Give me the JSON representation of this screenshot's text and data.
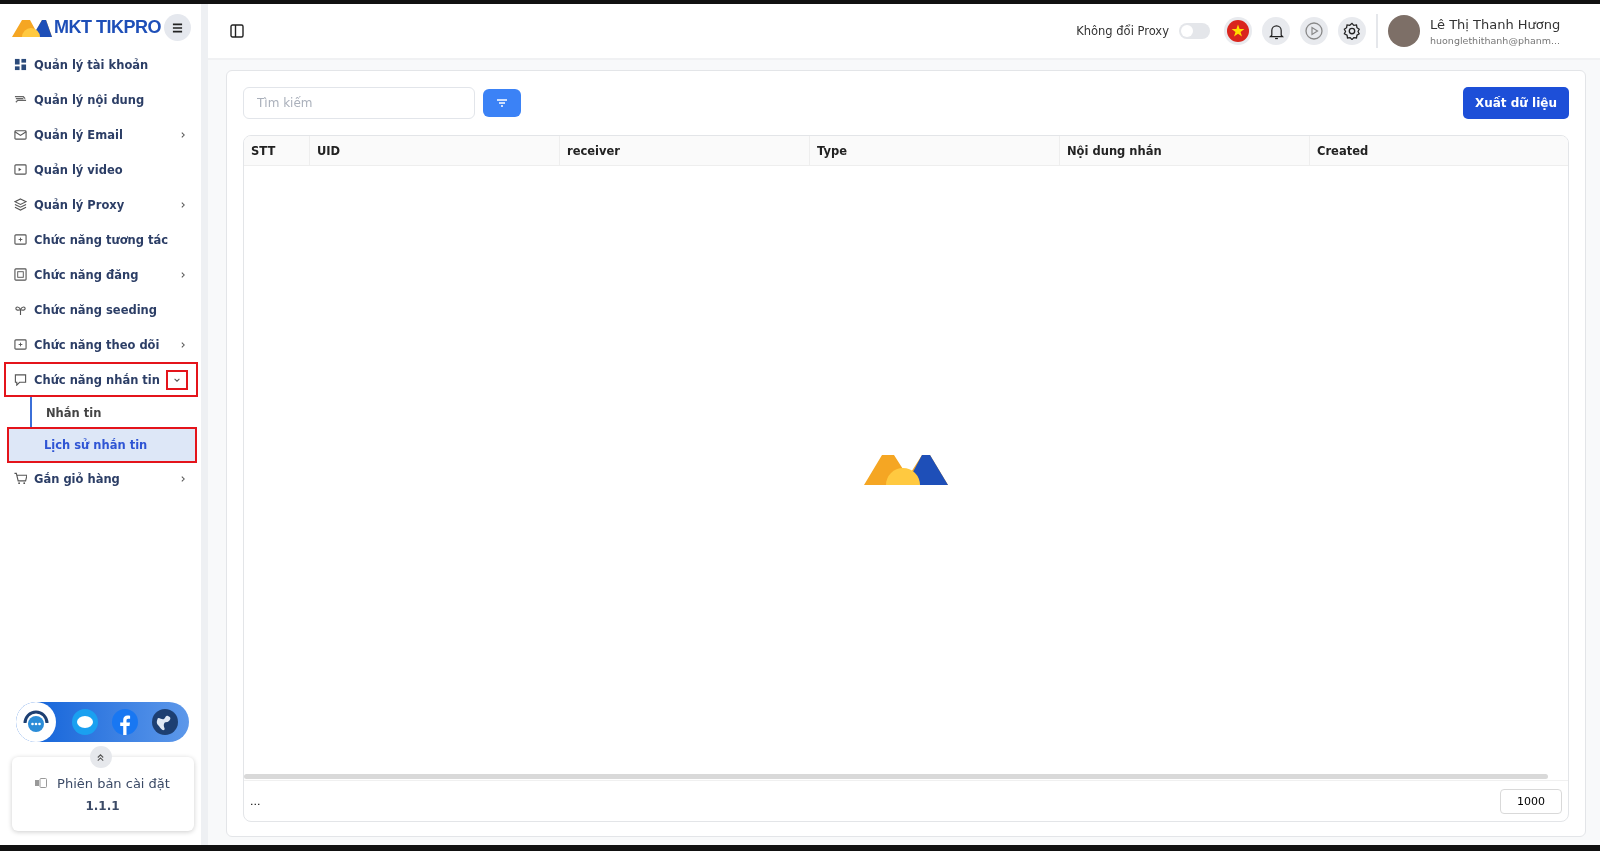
{
  "brand": {
    "name": "MKT TIKPRO"
  },
  "sidebar": {
    "items": [
      {
        "label": "Quản lý tài khoản",
        "highlighted": false
      },
      {
        "label": "Quản lý nội dung",
        "highlighted": false
      },
      {
        "label": "Quản lý Email",
        "expanded": false,
        "highlighted": false
      },
      {
        "label": "Quản lý video",
        "highlighted": false
      },
      {
        "label": "Quản lý Proxy",
        "expanded": false,
        "highlighted": false
      },
      {
        "label": "Chức năng tương tác",
        "highlighted": false
      },
      {
        "label": "Chức năng đăng",
        "expanded": false,
        "highlighted": false
      },
      {
        "label": "Chức năng seeding",
        "highlighted": false
      },
      {
        "label": "Chức năng theo dõi",
        "expanded": false,
        "highlighted": false
      },
      {
        "label": "Chức năng nhắn tin",
        "expanded": true,
        "highlighted": true,
        "children": [
          {
            "label": "Nhắn tin",
            "selected": false,
            "highlighted": false
          },
          {
            "label": "Lịch sử nhắn tin",
            "selected": true,
            "highlighted": true
          }
        ]
      },
      {
        "label": "Gắn giỏ hàng",
        "expanded": false,
        "highlighted": false
      }
    ]
  },
  "version_card": {
    "label": "Phiên bản cài đặt",
    "version": "1.1.1"
  },
  "header": {
    "proxy_toggle": {
      "label": "Không đổi Proxy",
      "on": false
    },
    "user": {
      "name": "Lê Thị Thanh Hương",
      "email": "huonglethithanh@phanm..."
    }
  },
  "toolbar": {
    "search": {
      "placeholder": "Tìm kiếm"
    },
    "export_button": "Xuất dữ liệu"
  },
  "table": {
    "columns": [
      "STT",
      "UID",
      "receiver",
      "Type",
      "Nội dung nhắn",
      "Created"
    ]
  },
  "footer": {
    "left": "...",
    "page_size": "1000"
  }
}
